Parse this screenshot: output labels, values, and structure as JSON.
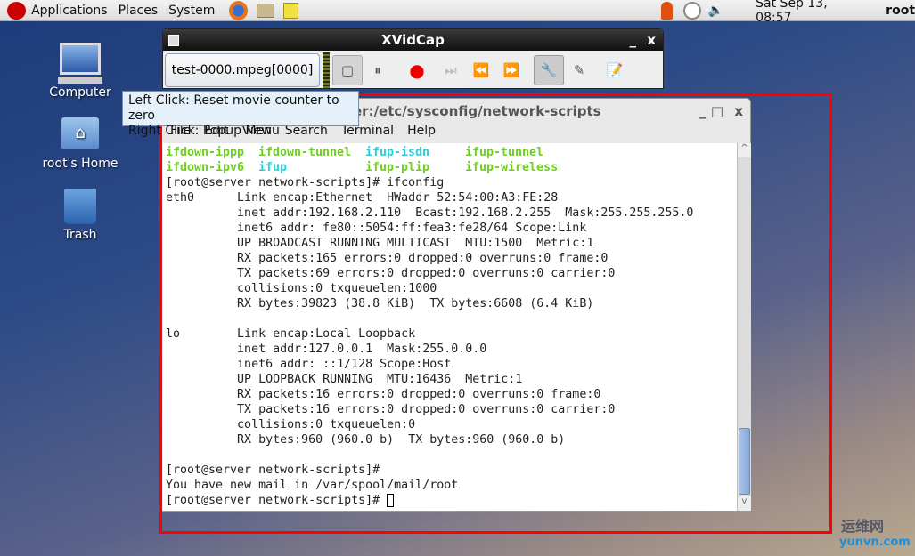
{
  "panel": {
    "menus": [
      "Applications",
      "Places",
      "System"
    ],
    "clock": "Sat Sep 13, 08:57",
    "user": "root"
  },
  "desktop": {
    "icons": [
      "Computer",
      "root's Home",
      "Trash"
    ]
  },
  "xvidcap": {
    "title": "XVidCap",
    "filename": "test-0000.mpeg[0000]"
  },
  "tooltip": {
    "line1": "Left Click: Reset movie counter to zero",
    "line2": "Right Click: Popup Menu"
  },
  "terminal": {
    "title": "er:/etc/sysconfig/network-scripts",
    "menu": [
      "File",
      "Edit",
      "View",
      "Search",
      "Terminal",
      "Help"
    ],
    "colors": {
      "green": "#6fcf20",
      "cyan": "#28d0d8"
    },
    "ls_rows": [
      [
        {
          "t": "ifdown-ippp",
          "c": "green"
        },
        {
          "t": "ifdown-tunnel",
          "c": "green"
        },
        {
          "t": "ifup-isdn",
          "c": "cyan"
        },
        {
          "t": "ifup-tunnel",
          "c": "green"
        }
      ],
      [
        {
          "t": "ifdown-ipv6",
          "c": "green"
        },
        {
          "t": "ifup",
          "c": "cyan"
        },
        {
          "t": "ifup-plip",
          "c": "green"
        },
        {
          "t": "ifup-wireless",
          "c": "green"
        }
      ]
    ],
    "lines": [
      "[root@server network-scripts]# ifconfig",
      "eth0      Link encap:Ethernet  HWaddr 52:54:00:A3:FE:28  ",
      "          inet addr:192.168.2.110  Bcast:192.168.2.255  Mask:255.255.255.0",
      "          inet6 addr: fe80::5054:ff:fea3:fe28/64 Scope:Link",
      "          UP BROADCAST RUNNING MULTICAST  MTU:1500  Metric:1",
      "          RX packets:165 errors:0 dropped:0 overruns:0 frame:0",
      "          TX packets:69 errors:0 dropped:0 overruns:0 carrier:0",
      "          collisions:0 txqueuelen:1000 ",
      "          RX bytes:39823 (38.8 KiB)  TX bytes:6608 (6.4 KiB)",
      "",
      "lo        Link encap:Local Loopback  ",
      "          inet addr:127.0.0.1  Mask:255.0.0.0",
      "          inet6 addr: ::1/128 Scope:Host",
      "          UP LOOPBACK RUNNING  MTU:16436  Metric:1",
      "          RX packets:16 errors:0 dropped:0 overruns:0 frame:0",
      "          TX packets:16 errors:0 dropped:0 overruns:0 carrier:0",
      "          collisions:0 txqueuelen:0 ",
      "          RX bytes:960 (960.0 b)  TX bytes:960 (960.0 b)",
      "",
      "[root@server network-scripts]# ",
      "You have new mail in /var/spool/mail/root",
      "[root@server network-scripts]# "
    ]
  },
  "watermark": {
    "cn": "运维网",
    "url": "yunvn.com"
  }
}
